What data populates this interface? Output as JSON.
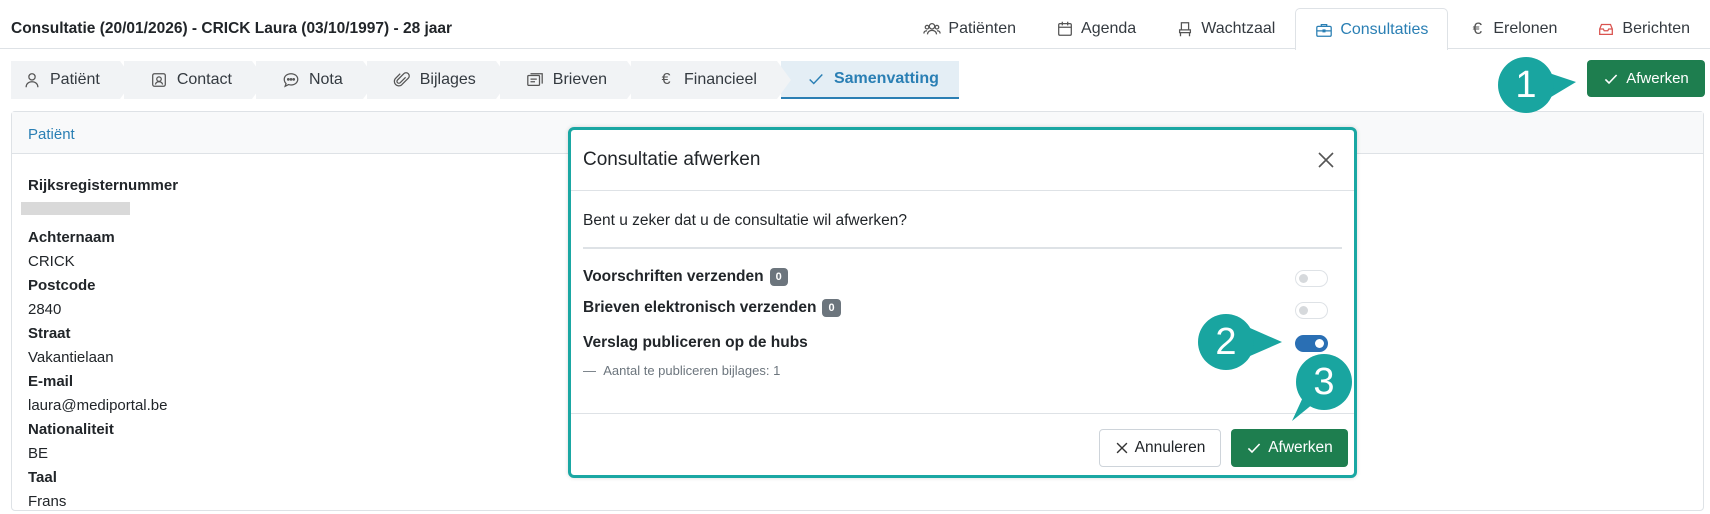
{
  "header": {
    "title": "Consultatie (20/01/2026) - CRICK Laura (03/10/1997) - 28 jaar"
  },
  "nav": [
    {
      "label": "Patiënten",
      "icon": "users-icon"
    },
    {
      "label": "Agenda",
      "icon": "calendar-icon"
    },
    {
      "label": "Wachtzaal",
      "icon": "chair-icon"
    },
    {
      "label": "Consultaties",
      "icon": "briefcase-icon",
      "active": true
    },
    {
      "label": "Erelonen",
      "icon": "euro-icon"
    },
    {
      "label": "Berichten",
      "icon": "inbox-icon"
    }
  ],
  "steps": [
    {
      "label": "Patiënt",
      "icon": "person-icon"
    },
    {
      "label": "Contact",
      "icon": "contact-card-icon"
    },
    {
      "label": "Nota",
      "icon": "chat-icon"
    },
    {
      "label": "Bijlages",
      "icon": "paperclip-icon"
    },
    {
      "label": "Brieven",
      "icon": "letters-icon"
    },
    {
      "label": "Financieel",
      "icon": "euro-icon"
    },
    {
      "label": "Samenvatting",
      "icon": "check-icon",
      "active": true
    }
  ],
  "finish_button_label": "Afwerken",
  "card": {
    "title": "Patiënt",
    "fields": [
      {
        "label": "Rijksregisternummer",
        "value": ""
      },
      {
        "label": "Achternaam",
        "value": "CRICK"
      },
      {
        "label": "Postcode",
        "value": "2840"
      },
      {
        "label": "Straat",
        "value": "Vakantielaan"
      },
      {
        "label": "E-mail",
        "value": "laura@mediportal.be"
      },
      {
        "label": "Nationaliteit",
        "value": "BE"
      },
      {
        "label": "Taal",
        "value": "Frans"
      }
    ]
  },
  "modal": {
    "title": "Consultatie afwerken",
    "question": "Bent u zeker dat u de consultatie wil afwerken?",
    "options": [
      {
        "label": "Voorschriften verzenden",
        "badge": "0",
        "on": false
      },
      {
        "label": "Brieven elektronisch verzenden",
        "badge": "0",
        "on": false
      },
      {
        "label": "Verslag publiceren op de hubs",
        "on": true
      }
    ],
    "sub_dash": "—",
    "sub_text": "Aantal te publiceren bijlages: 1",
    "cancel_label": "Annuleren",
    "finish_label": "Afwerken"
  },
  "markers": [
    "1",
    "2",
    "3"
  ],
  "colors": {
    "accent": "#2a7fb4",
    "success": "#1e7e4f",
    "annotation": "#19a5a0"
  }
}
